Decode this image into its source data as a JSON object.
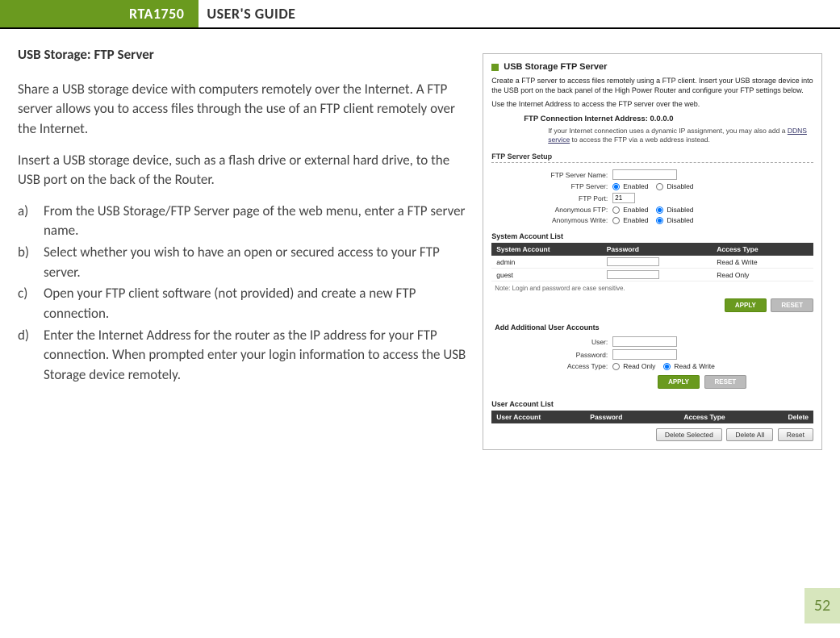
{
  "header": {
    "model": "RTA1750",
    "guide": "USER'S GUIDE"
  },
  "page_number": "52",
  "doc": {
    "section_title": "USB Storage: FTP Server",
    "para1": "Share a USB storage device with computers remotely over the Internet. A FTP server allows you to access files through the use of an FTP client remotely over the Internet.",
    "para2": "Insert a USB storage device, such as a flash drive or external hard drive, to the USB port on the back of the Router.",
    "steps": [
      {
        "marker": "a)",
        "text": "From the USB Storage/FTP Server page of the web menu, enter a FTP server name."
      },
      {
        "marker": "b)",
        "text": "Select whether you wish to have an open or secured access to your FTP server."
      },
      {
        "marker": "c)",
        "text": "Open your FTP client software (not provided) and create a new FTP connection."
      },
      {
        "marker": "d)",
        "text": "Enter the Internet Address for the router as the IP address for your FTP connection.  When prompted enter your login information to access the USB Storage device remotely."
      }
    ]
  },
  "screenshot": {
    "title": "USB Storage FTP Server",
    "desc": "Create a FTP server to access files remotely using a FTP client. Insert your USB storage device into the USB port on the back panel of the High Power Router and configure your FTP settings below.",
    "sub": "Use the Internet Address to access the FTP server over the web.",
    "conn_title": "FTP Connection Internet Address:  0.0.0.0",
    "conn_note_1": "If your Internet connection uses a dynamic IP assignment, you may also add a ",
    "conn_note_link": "DDNS service",
    "conn_note_2": " to access the FTP via a web address instead.",
    "server_setup_head": "FTP Server Setup",
    "fields": {
      "server_name_lbl": "FTP Server Name:",
      "server_name_val": "",
      "server_lbl": "FTP Server:",
      "port_lbl": "FTP Port:",
      "port_val": "21",
      "anon_ftp_lbl": "Anonymous FTP:",
      "anon_write_lbl": "Anonymous Write:",
      "enabled": "Enabled",
      "disabled": "Disabled"
    },
    "sys_list_head": "System Account List",
    "sys_cols": {
      "c1": "System Account",
      "c2": "Password",
      "c3": "Access Type"
    },
    "sys_rows": [
      {
        "acct": "admin",
        "pw": "",
        "access": "Read & Write"
      },
      {
        "acct": "guest",
        "pw": "",
        "access": "Read Only"
      }
    ],
    "note": "Note: Login and password are case sensitive.",
    "btn_apply": "APPLY",
    "btn_reset": "RESET",
    "add_head": "Add Additional User Accounts",
    "add_fields": {
      "user_lbl": "User:",
      "pw_lbl": "Password:",
      "access_lbl": "Access Type:",
      "ro": "Read Only",
      "rw": "Read & Write"
    },
    "ua_head": "User Account List",
    "ua_cols": {
      "c1": "User Account",
      "c2": "Password",
      "c3": "Access Type",
      "c4": "Delete"
    },
    "btn_del_sel": "Delete Selected",
    "btn_del_all": "Delete All",
    "btn_reset2": "Reset"
  }
}
